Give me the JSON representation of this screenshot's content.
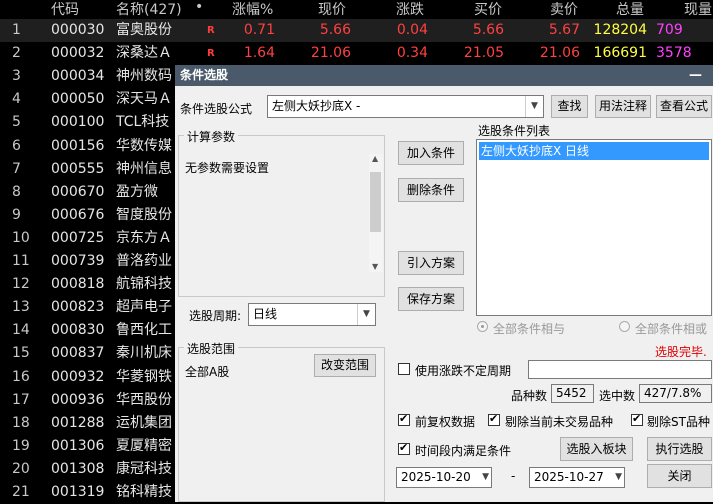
{
  "table": {
    "headers": {
      "code": "代码",
      "name": "名称(427)",
      "dot": "•",
      "pct": "涨幅%",
      "price": "现价",
      "chg": "涨跌",
      "buy": "买价",
      "sell": "卖价",
      "vol": "总量",
      "cur": "现量"
    },
    "rows": [
      {
        "idx": "1",
        "code": "000030",
        "name": "富奥股份",
        "flag": "R",
        "pct": "0.71",
        "price": "5.66",
        "chg": "0.04",
        "buy": "5.66",
        "sell": "5.67",
        "vol": "128204",
        "cur": "709"
      },
      {
        "idx": "2",
        "code": "000032",
        "name": "深桑达Ａ",
        "flag": "R",
        "pct": "1.64",
        "price": "21.06",
        "chg": "0.34",
        "buy": "21.05",
        "sell": "21.06",
        "vol": "166691",
        "cur": "3578"
      },
      {
        "idx": "3",
        "code": "000034",
        "name": "神州数码"
      },
      {
        "idx": "4",
        "code": "000050",
        "name": "深天马Ａ"
      },
      {
        "idx": "5",
        "code": "000100",
        "name": "TCL科技"
      },
      {
        "idx": "6",
        "code": "000156",
        "name": "华数传媒"
      },
      {
        "idx": "7",
        "code": "000555",
        "name": "神州信息"
      },
      {
        "idx": "8",
        "code": "000670",
        "name": "盈方微"
      },
      {
        "idx": "9",
        "code": "000676",
        "name": "智度股份"
      },
      {
        "idx": "10",
        "code": "000725",
        "name": "京东方Ａ"
      },
      {
        "idx": "11",
        "code": "000739",
        "name": "普洛药业"
      },
      {
        "idx": "12",
        "code": "000818",
        "name": "航锦科技"
      },
      {
        "idx": "13",
        "code": "000823",
        "name": "超声电子"
      },
      {
        "idx": "14",
        "code": "000830",
        "name": "鲁西化工"
      },
      {
        "idx": "15",
        "code": "000837",
        "name": "秦川机床"
      },
      {
        "idx": "16",
        "code": "000932",
        "name": "华菱钢铁"
      },
      {
        "idx": "17",
        "code": "000936",
        "name": "华西股份"
      },
      {
        "idx": "18",
        "code": "001288",
        "name": "运机集团"
      },
      {
        "idx": "19",
        "code": "001306",
        "name": "夏厦精密"
      },
      {
        "idx": "20",
        "code": "001308",
        "name": "康冠科技"
      },
      {
        "idx": "21",
        "code": "001319",
        "name": "铭科精技"
      }
    ]
  },
  "dialog": {
    "title": "条件选股",
    "minimize": "—",
    "formula_label": "条件选股公式",
    "formula_value": "左侧大妖抄底X  -",
    "find_btn": "查找",
    "usage_btn": "用法注释",
    "view_btn": "查看公式",
    "calc_params_title": "计算参数",
    "calc_params_text": "无参数需要设置",
    "add_btn": "加入条件",
    "del_btn": "删除条件",
    "import_btn": "引入方案",
    "save_btn": "保存方案",
    "list_title": "选股条件列表",
    "list_items": [
      "左侧大妖抄底X  日线"
    ],
    "period_label": "选股周期:",
    "period_value": "日线",
    "radio_and": "全部条件相与",
    "radio_or": "全部条件相或",
    "status": "选股完毕.",
    "scope_title": "选股范围",
    "scope_text": "全部A股",
    "change_scope_btn": "改变范围",
    "use_range_label": "使用涨跌不定周期",
    "count_label": "品种数",
    "count_value": "5452",
    "selected_label": "选中数",
    "selected_value": "427/7.8%",
    "pre_adjust_label": "前复权数据",
    "exclude_untraded_label": "剔除当前未交易品种",
    "exclude_st_label": "剔除ST品种",
    "time_range_label": "时间段内满足条件",
    "to_block_btn": "选股入板块",
    "run_btn": "执行选股",
    "date_from": "2025-10-20",
    "date_sep": "-",
    "date_to": "2025-10-27",
    "close_btn": "关闭"
  }
}
